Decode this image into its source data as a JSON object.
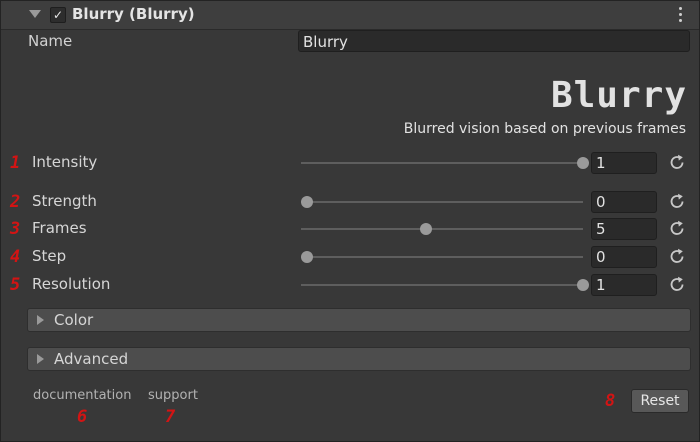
{
  "header": {
    "title": "Blurry (Blurry)",
    "enabled_checkmark": "✓"
  },
  "name_row": {
    "label": "Name",
    "value": "Blurry"
  },
  "logo": {
    "text": "Blurry"
  },
  "subtitle": "Blurred vision based on previous frames",
  "params": [
    {
      "number": "1",
      "label": "Intensity",
      "value": "1",
      "slider_fraction": 1.0
    },
    {
      "number": "2",
      "label": "Strength",
      "value": "0",
      "slider_fraction": 0.0
    },
    {
      "number": "3",
      "label": "Frames",
      "value": "5",
      "slider_fraction": 0.43
    },
    {
      "number": "4",
      "label": "Step",
      "value": "0",
      "slider_fraction": 0.0
    },
    {
      "number": "5",
      "label": "Resolution",
      "value": "1",
      "slider_fraction": 1.0
    }
  ],
  "sections": [
    {
      "label": "Color"
    },
    {
      "label": "Advanced"
    }
  ],
  "footer": {
    "documentation": "documentation",
    "documentation_number": "6",
    "support": "support",
    "support_number": "7",
    "reset_number": "8",
    "reset_label": "Reset"
  },
  "colors": {
    "accent_numbers": "#d21414",
    "background": "#383838"
  },
  "icons": [
    "foldout-arrow-icon",
    "kebab-menu-icon",
    "reset-circular-arrow-icon",
    "section-arrow-icon"
  ]
}
